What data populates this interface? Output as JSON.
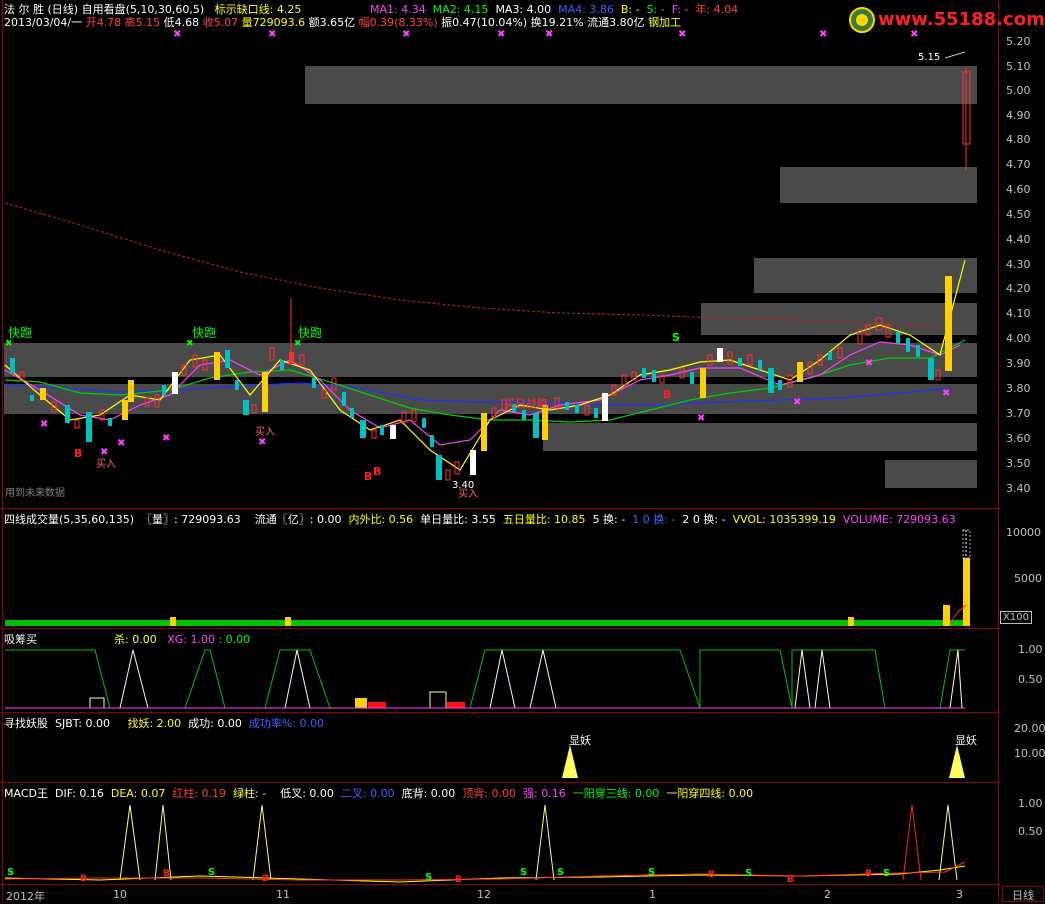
{
  "header": {
    "stock_name": "法 尔 胜",
    "period": "(日线)",
    "indicator": "自用看盘(5,10,30,60,5)",
    "gap_label": "标示缺口线:",
    "gap_value": "4.25",
    "ma1": "MA1: 4.34",
    "ma2": "MA2: 4.15",
    "ma3": "MA3: 4.00",
    "ma4": "MA4: 3.86",
    "b_label": "B: -",
    "s_label": "S: -",
    "f_label": "F: -",
    "year_label": "年: 4.04",
    "row2_date": "2013/03/04/一",
    "row2_open": "开4.78",
    "row2_high": "高5.15",
    "row2_low": "低4.68",
    "row2_close": "收5.07",
    "row2_vol": "量729093.6",
    "row2_amount": "额3.65亿",
    "row2_range": "幅0.39(8.33%)",
    "row2_amp": "振0.47(10.04%)",
    "row2_turn": "换19.21%",
    "row2_float": "流通3.80亿",
    "row2_sector": "钢加工"
  },
  "logo": {
    "text": "www.55188.com",
    "color": "#ff2020"
  },
  "price_axis": [
    "5.20",
    "5.10",
    "5.00",
    "4.90",
    "4.80",
    "4.70",
    "4.60",
    "4.50",
    "4.40",
    "4.30",
    "4.20",
    "4.10",
    "4.00",
    "3.90",
    "3.80",
    "3.70",
    "3.60",
    "3.50",
    "3.40"
  ],
  "main_annotations": {
    "kuaipao1": "快跑",
    "kuaipao2": "快跑",
    "kuaipao3": "快跑",
    "future_data": "用到未来数据",
    "low_price": "3.40",
    "high_price": "5.15",
    "buy1": "买入",
    "buy2": "买入",
    "buy3": "买入",
    "center_label": "买日战略",
    "s_mark": "S"
  },
  "volume_panel": {
    "title": "四线成交量(5,35,60,135)",
    "vol": "〖量〗: 729093.63",
    "float": "流通〖亿〗: 0.00",
    "inout": "内外比: 0.56",
    "single_ratio": "单日量比: 3.55",
    "five_ratio": "五日量比: 10.85",
    "turn5": "5 换: -",
    "turn10": "1 0 换: -",
    "turn20": "2 0 换: -",
    "vvol": "VVOL: 1035399.19",
    "volume": "VOLUME: 729093.63",
    "axis": [
      "10000",
      "5000"
    ],
    "multiplier": "X100"
  },
  "xichou_panel": {
    "title": "吸筹买",
    "sha": "杀: 0.00",
    "xg": "XG: 1.00",
    "val": ": 0.00",
    "axis": [
      "1.00",
      "0.50"
    ]
  },
  "yaogu_panel": {
    "title": "寻找妖股",
    "sjbt": "SJBT: 0.00",
    "zhaoyao": "找妖: 2.00",
    "chenggong": "成功: 0.00",
    "rate": "成功率%: 0.00",
    "axis": [
      "20.00",
      "10.00"
    ],
    "marker1": "显妖",
    "marker2": "显妖"
  },
  "macd_panel": {
    "title": "MACD王",
    "dif": "DIF: 0.16",
    "dea": "DEA: 0.07",
    "hongzhu": "红柱: 0.19",
    "lvzhu": "绿柱: -",
    "dicha": "低叉: 0.00",
    "erc": "二叉: 0.00",
    "dibei": "底背: 0.00",
    "dingbei": "顶背: 0.00",
    "qiang": "强: 0.16",
    "yiyang3": "一阳穿三线: 0.00",
    "yiyang4": "一阳穿四线: 0.00",
    "axis": [
      "1.00",
      "0.50"
    ]
  },
  "time_axis": {
    "labels": [
      "2012年",
      "10",
      "11",
      "12",
      "1",
      "2",
      "3"
    ],
    "period_button": "日线"
  },
  "colors": {
    "up": "#ff3030",
    "down": "#00c0c0",
    "ma5": "#ffffff",
    "ma10": "#ffff00",
    "ma30": "#ff40ff",
    "ma60": "#00ff00",
    "zone": "#4a4a4a",
    "grid": "#8b0000"
  }
}
